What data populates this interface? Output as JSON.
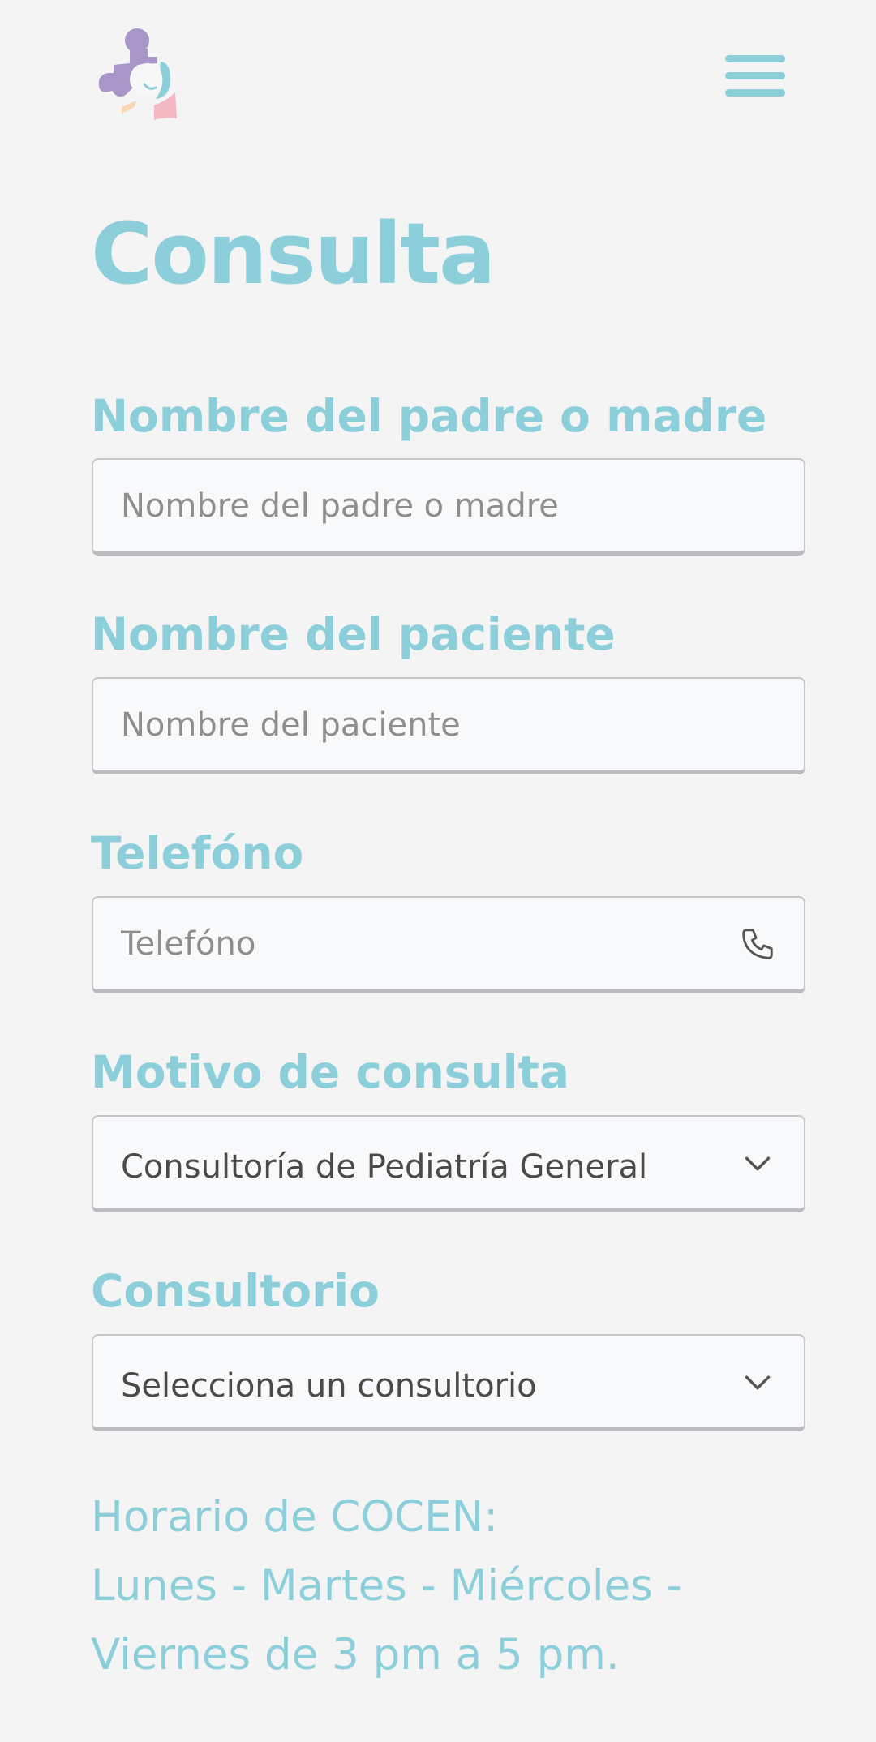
{
  "header": {
    "logo_icon": "puzzle-mother-child-logo",
    "menu_icon": "hamburger-menu-icon"
  },
  "page": {
    "title": "Consulta"
  },
  "form": {
    "parent_name": {
      "label": "Nombre del padre o madre",
      "placeholder": "Nombre del padre o madre",
      "value": ""
    },
    "patient_name": {
      "label": "Nombre del paciente",
      "placeholder": "Nombre del paciente",
      "value": ""
    },
    "phone": {
      "label": "Telefóno",
      "placeholder": "Telefóno",
      "value": "",
      "icon": "phone-icon"
    },
    "reason": {
      "label": "Motivo de consulta",
      "selected": "Consultoría de Pediatría General",
      "icon": "chevron-down-icon"
    },
    "office": {
      "label": "Consultorio",
      "selected": "Selecciona un consultorio",
      "icon": "chevron-down-icon"
    }
  },
  "schedule": {
    "line1": "Horario de COCEN:",
    "line2": "Lunes - Martes - Miércoles -",
    "line3": "Viernes de 3 pm a 5 pm."
  },
  "colors": {
    "accent": "#8ccfda",
    "background": "#f4f4f4",
    "field_background": "#f8f9fb",
    "logo_purple": "#a996c9",
    "logo_pink": "#f4b8c2",
    "logo_peach": "#f9d6b4"
  }
}
